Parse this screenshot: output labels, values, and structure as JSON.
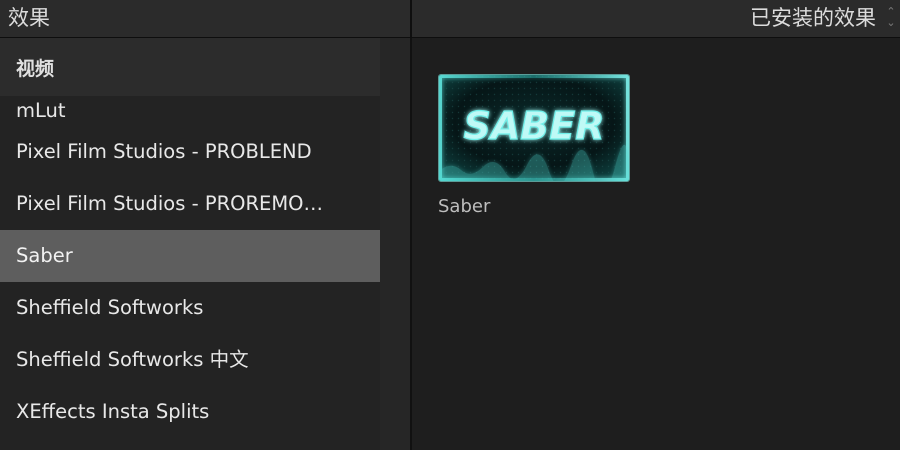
{
  "topbar": {
    "left_title": "效果",
    "right_title": "已安装的效果",
    "stepper_icon": "up-down-chevron-icon"
  },
  "sidebar": {
    "section_header": "视频",
    "items": [
      {
        "label": "mLut",
        "selected": false
      },
      {
        "label": "Pixel Film Studios - PROBLEND",
        "selected": false
      },
      {
        "label": "Pixel Film Studios - PROREMO…",
        "selected": false
      },
      {
        "label": "Saber",
        "selected": true
      },
      {
        "label": "Sheffield Softworks",
        "selected": false
      },
      {
        "label": "Sheffield Softworks 中文",
        "selected": false
      },
      {
        "label": "XEffects Insta Splits",
        "selected": false
      }
    ]
  },
  "content": {
    "effects": [
      {
        "name": "Saber",
        "thumbnail_text": "SABER"
      }
    ]
  },
  "colors": {
    "selection": "#5e5e5e",
    "thumbnail_glow": "#7ff3ee",
    "thumbnail_border": "#5b9c98"
  }
}
